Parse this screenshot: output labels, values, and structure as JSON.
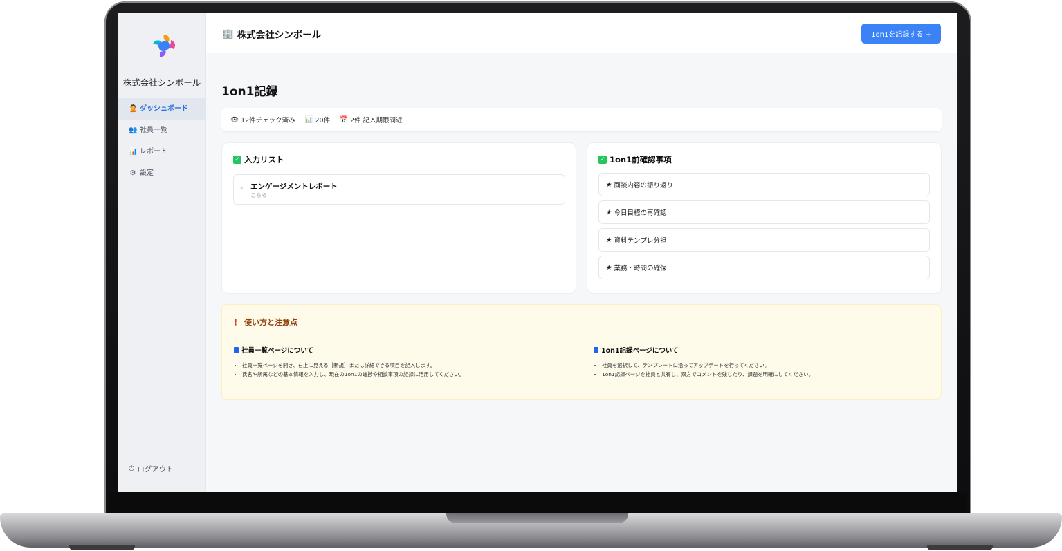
{
  "sidebar": {
    "company_name": "株式会社シンボール",
    "items": [
      {
        "icon": "🙎",
        "label": "ダッシュボード",
        "active": true
      },
      {
        "icon": "👥",
        "label": "社員一覧"
      },
      {
        "icon": "📊",
        "label": "レポート"
      },
      {
        "icon": "⚙",
        "label": "設定"
      }
    ],
    "logout_icon": "⏻",
    "logout_label": "ログアウト"
  },
  "header": {
    "icon": "🏢",
    "title": "株式会社シンボール",
    "record_button": "1on1を記録する +"
  },
  "main": {
    "page_title": "1on1記録",
    "stats": [
      {
        "icon": "👁",
        "text": "12件チェック済み"
      },
      {
        "icon": "📊",
        "text": "20件"
      },
      {
        "icon": "📅",
        "text": "2件 記入期限間近"
      }
    ],
    "input_list": {
      "check_icon": "✓",
      "title": "入力リスト",
      "items": [
        {
          "arrow": "»",
          "title": "エンゲージメントレポート",
          "sub": "こちら"
        }
      ]
    },
    "precheck": {
      "check_icon": "✓",
      "title": "1on1前確認事項",
      "star": "★",
      "items": [
        "面談内容の振り返り",
        "今日目標の再確認",
        "資料テンプレ分担",
        "業務・時間の確保"
      ]
    },
    "notice": {
      "bang": "！",
      "title": "使い方と注意点",
      "columns": [
        {
          "heading": "社員一覧ページについて",
          "items": [
            "社員一覧ページを開き、右上に見える［新規］または詳細できる項目を記入します。",
            "氏名や所属などの基本情報を入力し、現在の1on1の進捗や相談事項の記録に活用してください。"
          ]
        },
        {
          "heading": "1on1記録ページについて",
          "items": [
            "社員を選択して、テンプレートに沿ってアップデートを行ってください。",
            "1on1記録ページを社員と共有し、双方でコメントを残したり、課題を明確にしてください。"
          ]
        }
      ]
    }
  },
  "colors": {
    "accent": "#3b82f6",
    "active_nav": "#2f6fde",
    "notice_bg": "#fffbea",
    "check_green": "#22c55e"
  }
}
